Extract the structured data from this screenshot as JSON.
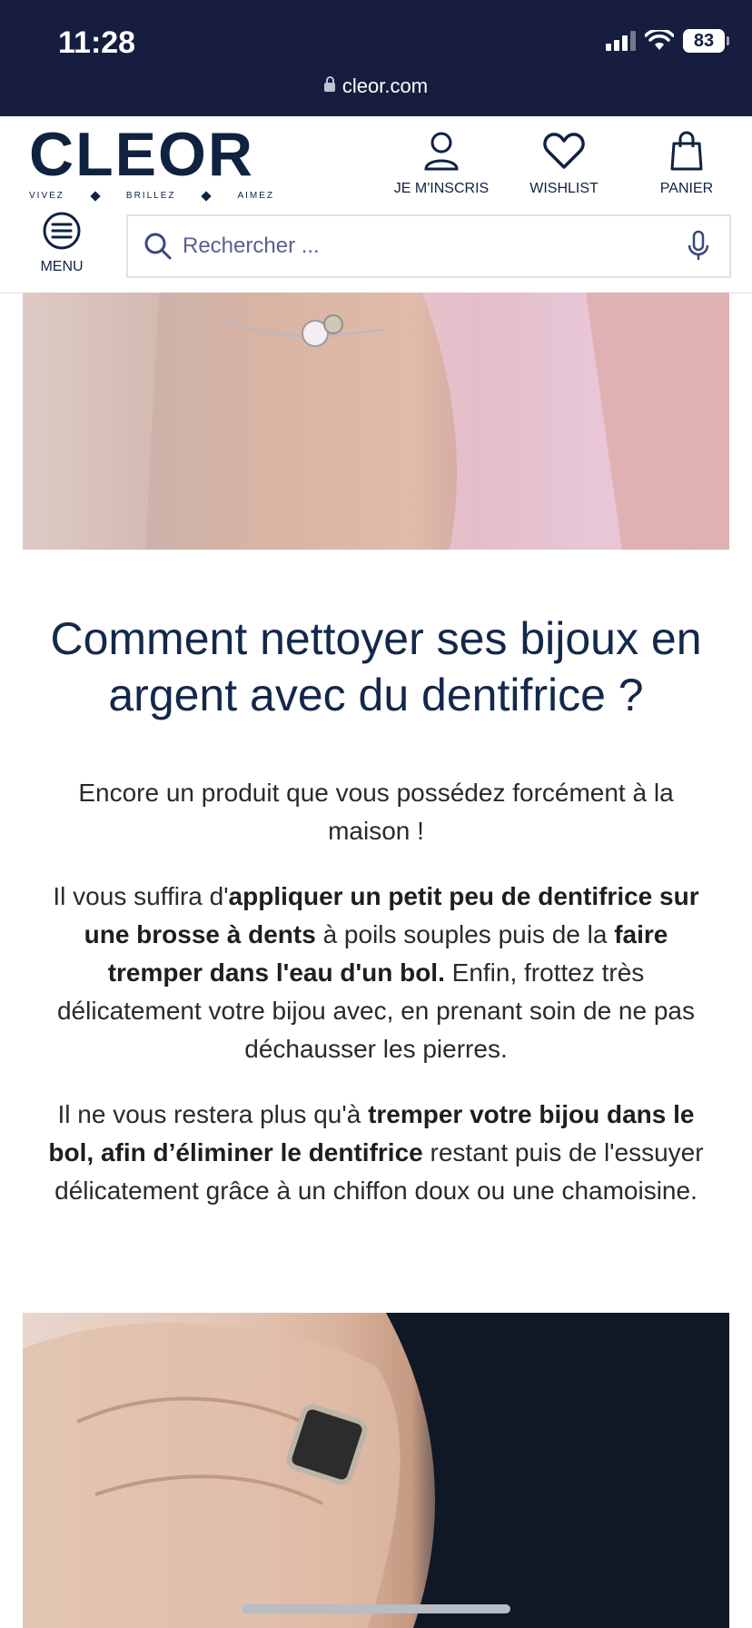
{
  "status_bar": {
    "time": "11:28",
    "battery": "83",
    "url": "cleor.com"
  },
  "header": {
    "logo": "CLEOR",
    "tagline": [
      "VIVEZ",
      "BRILLEZ",
      "AIMEZ"
    ],
    "account_label": "JE M'INSCRIS",
    "wishlist_label": "WISHLIST",
    "cart_label": "PANIER",
    "menu_label": "MENU",
    "search_placeholder": "Rechercher ..."
  },
  "article": {
    "title": "Comment nettoyer ses bijoux en argent avec du dentifrice ?",
    "para1": "Encore un produit que vous possédez forcément à la maison !",
    "para2": {
      "t1": "Il vous suffira d'",
      "b1": "appliquer un petit peu de dentifrice sur une brosse à dents",
      "t2": " à poils souples puis de la ",
      "b2": "faire tremper dans l'eau d'un bol.",
      "t3": " Enfin, frottez très délicatement votre bijou avec, en prenant soin de ne pas déchausser les pierres."
    },
    "para3": {
      "t1": "Il ne vous restera plus qu'à ",
      "b1": "tremper votre bijou dans le bol, afin d’éliminer le dentifrice",
      "t2": " restant puis de l'essuyer délicatement grâce à un chiffon doux ou une chamoisine."
    }
  },
  "colors": {
    "status_bar_bg": "#161d3f",
    "brand_navy": "#0f2240",
    "title_color": "#13284a"
  },
  "icons": [
    "user-icon",
    "heart-icon",
    "bag-icon",
    "menu-icon",
    "search-icon",
    "microphone-icon",
    "lock-icon",
    "wifi-icon",
    "signal-icon",
    "battery-icon"
  ]
}
